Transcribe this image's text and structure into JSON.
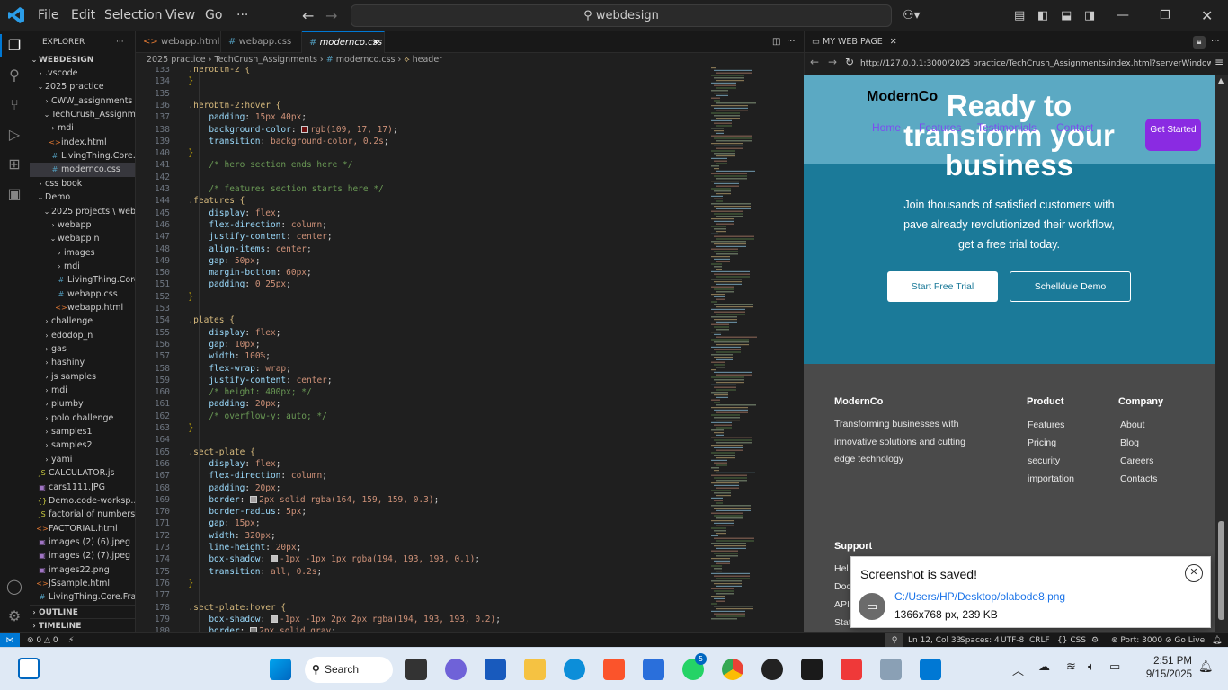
{
  "window": {
    "search": "webdesign",
    "menus": [
      "File",
      "Edit",
      "Selection",
      "View",
      "Go",
      "···"
    ]
  },
  "sidebar": {
    "title": "EXPLORER",
    "root": "WEBDESIGN",
    "outline": "OUTLINE",
    "timeline": "TIMELINE",
    "items": [
      {
        "label": ".vscode",
        "kind": "folder-closed",
        "depth": 1
      },
      {
        "label": "2025 practice",
        "kind": "folder-open",
        "depth": 1
      },
      {
        "label": "CWW_assignments",
        "kind": "folder-closed",
        "depth": 2
      },
      {
        "label": "TechCrush_Assignm...",
        "kind": "folder-open",
        "depth": 2
      },
      {
        "label": "mdi",
        "kind": "folder-closed",
        "depth": 3
      },
      {
        "label": "index.html",
        "kind": "html",
        "depth": 3
      },
      {
        "label": "LivingThing.Core.Fr...",
        "kind": "css",
        "depth": 3
      },
      {
        "label": "modernco.css",
        "kind": "css",
        "depth": 3,
        "selected": true
      },
      {
        "label": "css book",
        "kind": "folder-closed",
        "depth": 1
      },
      {
        "label": "Demo",
        "kind": "folder-open",
        "depth": 1
      },
      {
        "label": "2025 projects \\ weba...",
        "kind": "folder-open",
        "depth": 2
      },
      {
        "label": "webapp",
        "kind": "folder-closed",
        "depth": 3
      },
      {
        "label": "webapp n",
        "kind": "folder-open",
        "depth": 3
      },
      {
        "label": "images",
        "kind": "folder-closed",
        "depth": 4
      },
      {
        "label": "mdi",
        "kind": "folder-closed",
        "depth": 4
      },
      {
        "label": "LivingThing.Core...",
        "kind": "css",
        "depth": 4
      },
      {
        "label": "webapp.css",
        "kind": "css",
        "depth": 4
      },
      {
        "label": "webapp.html",
        "kind": "html",
        "depth": 4
      },
      {
        "label": "challenge",
        "kind": "folder-closed",
        "depth": 2
      },
      {
        "label": "edodop_n",
        "kind": "folder-closed",
        "depth": 2
      },
      {
        "label": "gas",
        "kind": "folder-closed",
        "depth": 2
      },
      {
        "label": "hashiny",
        "kind": "folder-closed",
        "depth": 2
      },
      {
        "label": "js samples",
        "kind": "folder-closed",
        "depth": 2
      },
      {
        "label": "mdi",
        "kind": "folder-closed",
        "depth": 2
      },
      {
        "label": "plumby",
        "kind": "folder-closed",
        "depth": 2
      },
      {
        "label": "polo challenge",
        "kind": "folder-closed",
        "depth": 2
      },
      {
        "label": "samples1",
        "kind": "folder-closed",
        "depth": 2
      },
      {
        "label": "samples2",
        "kind": "folder-closed",
        "depth": 2
      },
      {
        "label": "yami",
        "kind": "folder-closed",
        "depth": 2
      },
      {
        "label": "CALCULATOR.js",
        "kind": "js",
        "depth": 1
      },
      {
        "label": "cars1111.JPG",
        "kind": "img",
        "depth": 1
      },
      {
        "label": "Demo.code-worksp...",
        "kind": "json",
        "depth": 1
      },
      {
        "label": "factorial of numbers.js",
        "kind": "js",
        "depth": 1
      },
      {
        "label": "FACTORIAL.html",
        "kind": "html",
        "depth": 1
      },
      {
        "label": "images (2) (6).jpeg",
        "kind": "img",
        "depth": 1
      },
      {
        "label": "images (2) (7).jpeg",
        "kind": "img",
        "depth": 1
      },
      {
        "label": "images22.png",
        "kind": "img",
        "depth": 1
      },
      {
        "label": "JSsample.html",
        "kind": "html",
        "depth": 1
      },
      {
        "label": "LivingThing.Core.Fra...",
        "kind": "css",
        "depth": 1
      }
    ]
  },
  "tabs": [
    {
      "label": "webapp.html",
      "icon": "<>"
    },
    {
      "label": "webapp.css",
      "icon": "#"
    },
    {
      "label": "modernco.css",
      "icon": "#",
      "active": true
    }
  ],
  "breadcrumb": [
    "2025 practice",
    "TechCrush_Assignments",
    "modernco.css",
    "header"
  ],
  "code": [
    {
      "n": "133",
      "t": "sel",
      "s": "  .herobtn-2 {"
    },
    {
      "n": "134",
      "t": "close",
      "s": "  }"
    },
    {
      "n": "135",
      "t": "blank",
      "s": ""
    },
    {
      "n": "136",
      "t": "sel",
      "s": "  .herobtn-2:hover {"
    },
    {
      "n": "137",
      "t": "prop",
      "p": "padding",
      "v": "15px 40px"
    },
    {
      "n": "138",
      "t": "prop",
      "p": "background-color",
      "v": "rgb(109, 17, 17)",
      "sw": "#6d1111"
    },
    {
      "n": "139",
      "t": "prop",
      "p": "transition",
      "v": "background-color, 0.2s"
    },
    {
      "n": "140",
      "t": "close",
      "s": "  }"
    },
    {
      "n": "141",
      "t": "cmt",
      "s": "      /* hero section ends here */"
    },
    {
      "n": "142",
      "t": "blank",
      "s": ""
    },
    {
      "n": "143",
      "t": "cmt",
      "s": "      /* features section starts here */"
    },
    {
      "n": "144",
      "t": "sel",
      "s": "  .features {"
    },
    {
      "n": "145",
      "t": "prop",
      "p": "display",
      "v": "flex"
    },
    {
      "n": "146",
      "t": "prop",
      "p": "flex-direction",
      "v": "column"
    },
    {
      "n": "147",
      "t": "prop",
      "p": "justify-content",
      "v": "center"
    },
    {
      "n": "148",
      "t": "prop",
      "p": "align-items",
      "v": "center"
    },
    {
      "n": "149",
      "t": "prop",
      "p": "gap",
      "v": "50px"
    },
    {
      "n": "150",
      "t": "prop",
      "p": "margin-bottom",
      "v": "60px"
    },
    {
      "n": "151",
      "t": "prop",
      "p": "padding",
      "v": "0 25px"
    },
    {
      "n": "152",
      "t": "close",
      "s": "  }"
    },
    {
      "n": "153",
      "t": "blank",
      "s": ""
    },
    {
      "n": "154",
      "t": "sel",
      "s": "  .plates {"
    },
    {
      "n": "155",
      "t": "prop",
      "p": "display",
      "v": "flex"
    },
    {
      "n": "156",
      "t": "prop",
      "p": "gap",
      "v": "10px"
    },
    {
      "n": "157",
      "t": "prop",
      "p": "width",
      "v": "100%"
    },
    {
      "n": "158",
      "t": "prop",
      "p": "flex-wrap",
      "v": "wrap"
    },
    {
      "n": "159",
      "t": "prop",
      "p": "justify-content",
      "v": "center"
    },
    {
      "n": "160",
      "t": "cmt",
      "s": "      /* height: 400px; */"
    },
    {
      "n": "161",
      "t": "prop",
      "p": "padding",
      "v": "20px"
    },
    {
      "n": "162",
      "t": "cmt",
      "s": "      /* overflow-y: auto; */"
    },
    {
      "n": "163",
      "t": "close",
      "s": "  }"
    },
    {
      "n": "164",
      "t": "blank",
      "s": ""
    },
    {
      "n": "165",
      "t": "sel",
      "s": "  .sect-plate {"
    },
    {
      "n": "166",
      "t": "prop",
      "p": "display",
      "v": "flex"
    },
    {
      "n": "167",
      "t": "prop",
      "p": "flex-direction",
      "v": "column"
    },
    {
      "n": "168",
      "t": "prop",
      "p": "padding",
      "v": "20px"
    },
    {
      "n": "169",
      "t": "prop",
      "p": "border",
      "v": "2px solid rgba(164, 159, 159, 0.3)",
      "sw": "#a49f9f"
    },
    {
      "n": "170",
      "t": "prop",
      "p": "border-radius",
      "v": "5px"
    },
    {
      "n": "171",
      "t": "prop",
      "p": "gap",
      "v": "15px"
    },
    {
      "n": "172",
      "t": "prop",
      "p": "width",
      "v": "320px"
    },
    {
      "n": "173",
      "t": "prop",
      "p": "line-height",
      "v": "20px"
    },
    {
      "n": "174",
      "t": "prop",
      "p": "box-shadow",
      "v": "-1px -1px 1px rgba(194, 193, 193, 0.1)",
      "sw": "#c2c1c1"
    },
    {
      "n": "175",
      "t": "prop",
      "p": "transition",
      "v": "all, 0.2s"
    },
    {
      "n": "176",
      "t": "close",
      "s": "  }"
    },
    {
      "n": "177",
      "t": "blank",
      "s": ""
    },
    {
      "n": "178",
      "t": "sel",
      "s": "  .sect-plate:hover {"
    },
    {
      "n": "179",
      "t": "prop",
      "p": "box-shadow",
      "v": "-1px -1px 2px 2px rgba(194, 193, 193, 0.2)",
      "sw": "#c2c1c1"
    },
    {
      "n": "180",
      "t": "prop",
      "p": "border",
      "v": "2px solid gray",
      "sw": "#808080"
    }
  ],
  "preview": {
    "tab": "MY WEB PAGE",
    "url": "http://127.0.0.1:3000/2025 practice/TechCrush_Assignments/index.html?serverWindowId=49",
    "brand": "ModernCo",
    "hero_title_1": "Ready to",
    "hero_title_2": "transform your",
    "hero_title_3": "business",
    "nav": [
      "Home",
      "Features",
      "Testimonials",
      "Contact"
    ],
    "cta": "Get Started",
    "sub_1": "Join thousands of satisfied customers with",
    "sub_2": "pave already revolutionized their workflow,",
    "sub_3": "get a free trial today.",
    "btn_trial": "Start Free Trial",
    "btn_demo": "Schelldule Demo",
    "footer": {
      "brand": "ModernCo",
      "desc": [
        "Transforming businesses with",
        "innovative solutions and cutting",
        "edge technology"
      ],
      "product_head": "Product",
      "product": [
        "Features",
        "Pricing",
        "security",
        "importation"
      ],
      "company_head": "Company",
      "company": [
        "About",
        "Blog",
        "Careers",
        "Contacts"
      ],
      "support_head": "Support",
      "support_partial": [
        "Hel",
        "Doc",
        "API",
        "Stat"
      ]
    }
  },
  "toast": {
    "title": "Screenshot is saved!",
    "path": "C:/Users/HP/Desktop/olabode8.png",
    "info": "1366x768 px, 239 KB"
  },
  "status": {
    "errors": "0",
    "warnings": "0",
    "position": "Ln 12, Col 33",
    "spaces": "Spaces: 4",
    "encoding": "UTF-8",
    "eol": "CRLF",
    "lang": "CSS",
    "port": "Port: 3000",
    "golive": "Go Live"
  },
  "taskbar": {
    "search": "Search",
    "whatsapp_badge": "5",
    "time": "2:51 PM",
    "date": "9/15/2025"
  }
}
